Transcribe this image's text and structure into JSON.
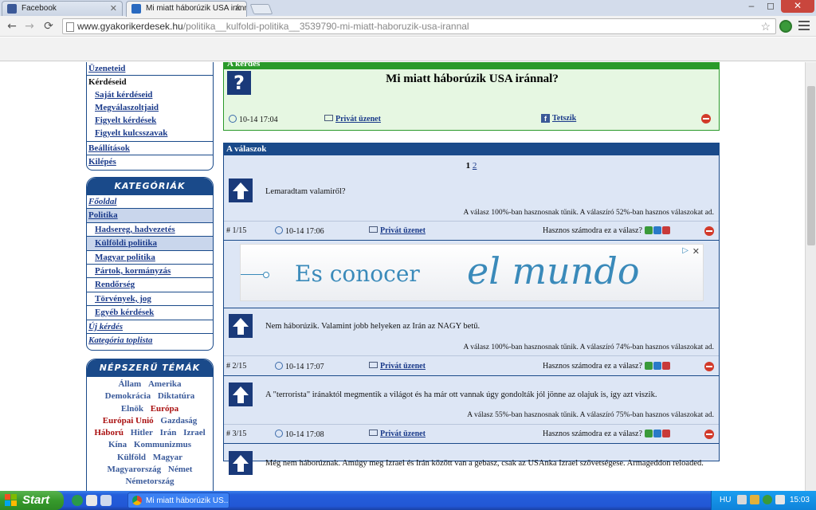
{
  "browser": {
    "tabs": [
      {
        "label": "Facebook",
        "active": false
      },
      {
        "label": "Mi miatt háborúzik USA iránna",
        "active": true
      }
    ],
    "window_controls": {
      "minimize": "–",
      "maximize": "◻",
      "close": "✕"
    },
    "url_host": "www.gyakorikerdesek.hu",
    "url_path": "/politika__kulfoldi-politika__3539790-mi-miatt-haboruzik-usa-irannal",
    "back": "←",
    "forward": "→",
    "reload": "⟳",
    "star": "☆"
  },
  "sidebar": {
    "account": {
      "messages": "Üzeneteid",
      "questions_heading": "Kérdéseid",
      "question_items": [
        "Saját kérdéseid",
        "Megválaszoltjaid",
        "Figyelt kérdések",
        "Figyelt kulcsszavak"
      ],
      "settings": "Beállítások",
      "logout": "Kilépés"
    },
    "categories": {
      "heading": "KATEGÓRIÁK",
      "home": "Főoldal",
      "politics": "Politika",
      "sub_items": [
        "Hadsereg, hadvezetés",
        "Külföldi politika",
        "Magyar politika",
        "Pártok, kormányzás",
        "Rendőrség",
        "Törvények, jog",
        "Egyéb kérdések"
      ],
      "new_question": "Új kérdés",
      "toplist": "Kategória toplista"
    },
    "popular": {
      "heading": "NÉPSZERŰ TÉMÁK",
      "tags": [
        {
          "t": "Állam",
          "hot": false
        },
        {
          "t": "Amerika",
          "hot": false
        },
        {
          "t": "Demokrácia",
          "hot": false
        },
        {
          "t": "Diktatúra",
          "hot": false
        },
        {
          "t": "Elnök",
          "hot": false
        },
        {
          "t": "Európa",
          "hot": true
        },
        {
          "t": "Európai Unió",
          "hot": true
        },
        {
          "t": "Gazdaság",
          "hot": false
        },
        {
          "t": "Háború",
          "hot": true
        },
        {
          "t": "Hitler",
          "hot": false
        },
        {
          "t": "Irán",
          "hot": false
        },
        {
          "t": "Izrael",
          "hot": false
        },
        {
          "t": "Kína",
          "hot": false
        },
        {
          "t": "Kommunizmus",
          "hot": false
        },
        {
          "t": "Külföld",
          "hot": false
        },
        {
          "t": "Magyar",
          "hot": false
        },
        {
          "t": "Magyarország",
          "hot": false
        },
        {
          "t": "Német",
          "hot": false
        },
        {
          "t": "Németország",
          "hot": false
        }
      ]
    }
  },
  "question": {
    "header": "A kérdés",
    "icon": "?",
    "title": "Mi miatt háborúzik USA iránnal?",
    "time": "10-14 17:04",
    "private_msg": "Privát üzenet",
    "like": "Tetszik",
    "fb": "f"
  },
  "answers": {
    "header": "A válaszok",
    "pages": [
      "1",
      "2"
    ],
    "useful_prompt": "Hasznos számodra ez a válasz?",
    "private_msg": "Privát üzenet",
    "items": [
      {
        "num": "# 1/15",
        "time": "10-14 17:06",
        "text": "Lemaradtam valamiről?",
        "rating": "A válasz 100%-ban hasznosnak tűnik. A válaszíró 52%-ban hasznos válaszokat ad."
      },
      {
        "num": "# 2/15",
        "time": "10-14 17:07",
        "text": "Nem háborúzik. Valamint jobb helyeken az Irán az NAGY betű.",
        "rating": "A válasz 100%-ban hasznosnak tűnik. A válaszíró 74%-ban hasznos válaszokat ad."
      },
      {
        "num": "# 3/15",
        "time": "10-14 17:08",
        "text": "A \"terrorista\" iránaktól megmentik a világot és ha már ott vannak úgy gondolták jól jönne az olajuk is, így azt viszik.",
        "rating": "A válasz 55%-ban hasznosnak tűnik. A válaszíró 75%-ban hasznos válaszokat ad."
      },
      {
        "num": "",
        "time": "",
        "text": "Még nem háborúznak. Amúgy meg Izrael és Irán között van a gebasz, csak az USAnka Izrael szövetségese. Armageddon reloaded.",
        "rating": ""
      }
    ]
  },
  "ad": {
    "line1": "Es conocer",
    "line2": "el mundo",
    "info": "▷",
    "close": "✕"
  },
  "taskbar": {
    "start": "Start",
    "task": "Mi miatt háborúzik US...",
    "lang": "HU",
    "clock": "15:03"
  },
  "colors": {
    "brand_blue": "#1a4a8a",
    "question_green": "#2a9a2a",
    "hot_tag": "#aa1111"
  }
}
